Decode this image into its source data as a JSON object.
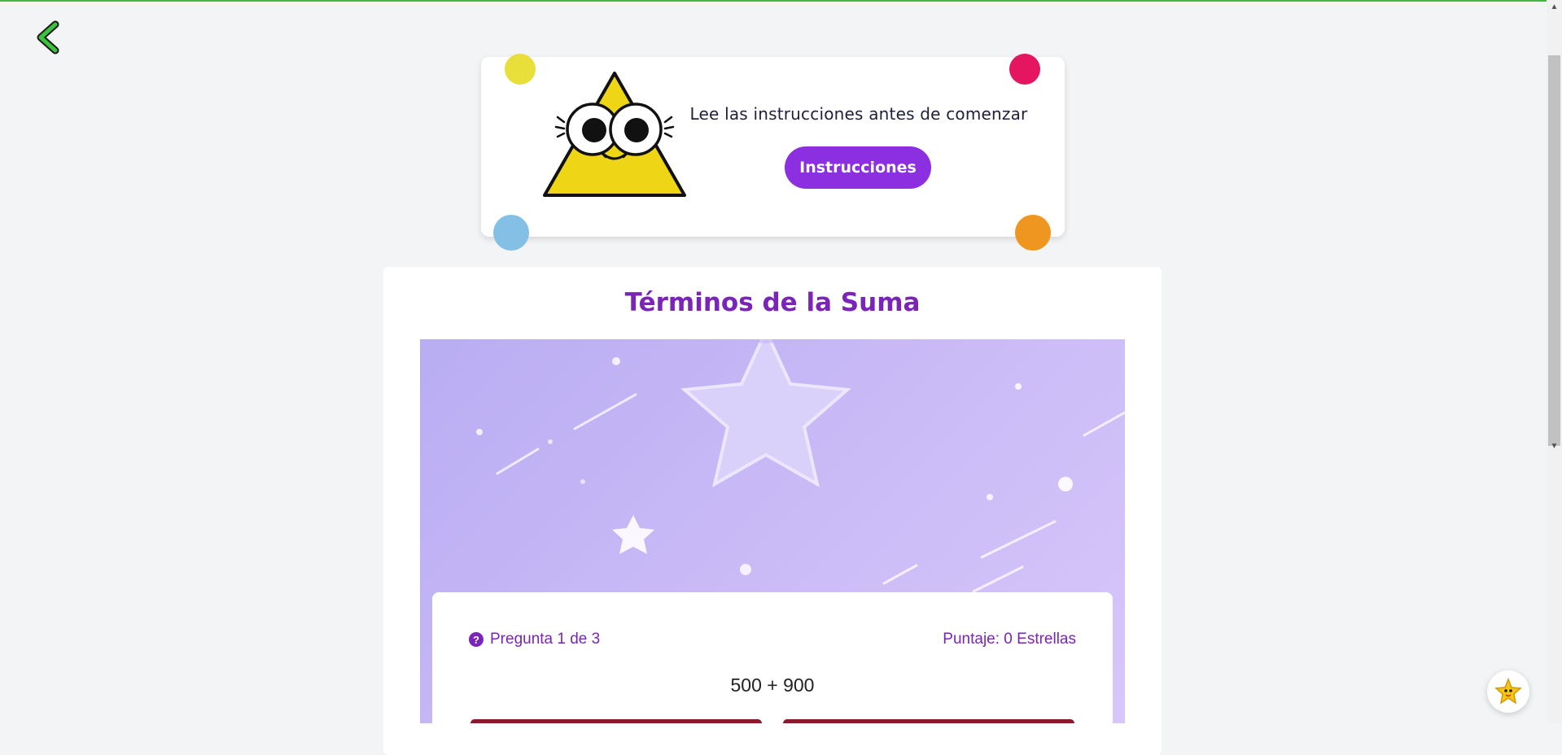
{
  "colors": {
    "accent": "#8b2fe0",
    "title": "#7a24b8",
    "top_line": "#3fb83f"
  },
  "nav": {
    "back_icon": "chevron-left-icon"
  },
  "intro": {
    "message": "Lee las instrucciones antes de comenzar",
    "button_label": "Instrucciones",
    "mascot": "triangle-mascot"
  },
  "lesson": {
    "title": "Términos de la Suma"
  },
  "quiz": {
    "counter": "Pregunta 1 de 3",
    "score": "Puntaje: 0 Estrellas",
    "question": "500 + 900"
  },
  "helper": {
    "icon": "star-helper-icon"
  }
}
